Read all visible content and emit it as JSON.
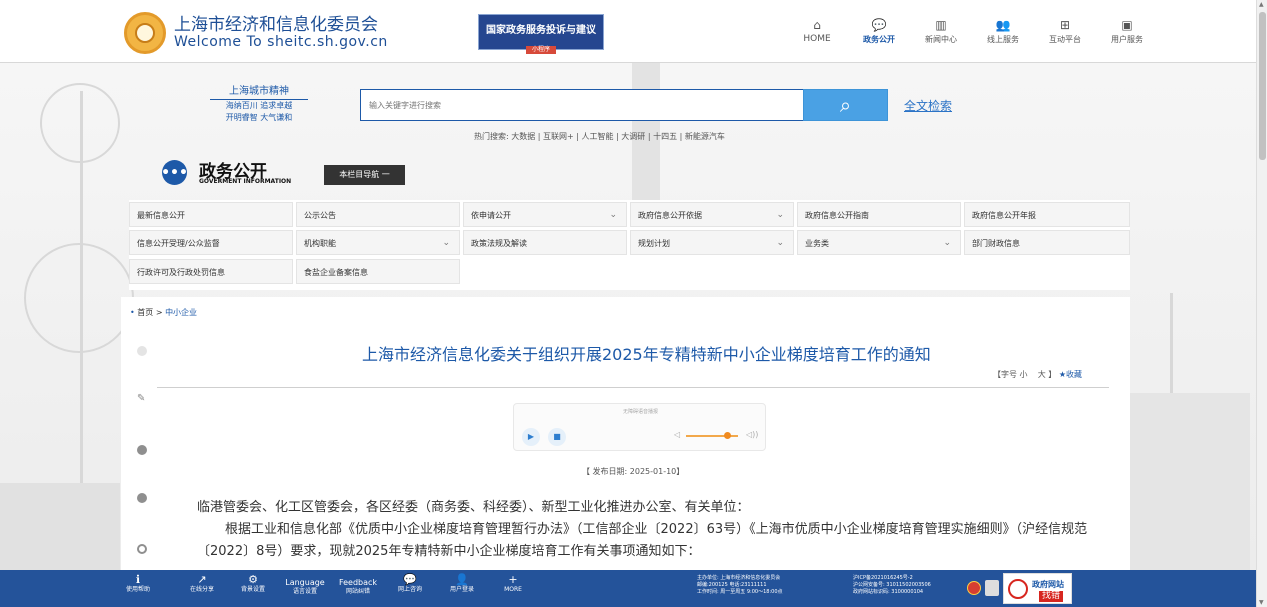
{
  "header": {
    "title": "上海市经济和信息化委员会",
    "subtitle": "Welcome To sheitc.sh.gov.cn",
    "banner": {
      "title": "国家政务服务投诉与建议",
      "sub": "小程序"
    },
    "nav": [
      {
        "label": "HOME",
        "icon": "home-icon",
        "glyph": "⌂"
      },
      {
        "label": "政务公开",
        "icon": "chat-icon",
        "glyph": "💬"
      },
      {
        "label": "新闻中心",
        "icon": "book-icon",
        "glyph": "▥"
      },
      {
        "label": "线上服务",
        "icon": "users-icon",
        "glyph": "👥"
      },
      {
        "label": "互动平台",
        "icon": "grid-icon",
        "glyph": "⊞"
      },
      {
        "label": "用户服务",
        "icon": "user-service-icon",
        "glyph": "▣"
      }
    ]
  },
  "hero": {
    "motto": {
      "title": "上海城市精神",
      "line1": "海纳百川 追求卓越",
      "line2": "开明睿智 大气谦和"
    },
    "search_placeholder": "输入关键字进行搜索",
    "search_icon": "search-icon",
    "full_search": "全文检索",
    "hot_search": "热门搜索: 大数据 | 互联网+ | 人工智能 | 大调研 | 十四五 | 新能源汽车"
  },
  "section": {
    "title": "政务公开",
    "subtitle": "GOVERMENT INFORMATION",
    "catalog_button": "本栏目导航 一"
  },
  "menu": [
    [
      "最新信息公开",
      "公示公告",
      "依申请公开",
      "政府信息公开依据",
      "政府信息公开指南",
      "政府信息公开年报"
    ],
    [
      "信息公开受理/公众监督",
      "机构职能",
      "政策法规及解读",
      "规划计划",
      "业务类",
      "部门财政信息"
    ],
    [
      "行政许可及行政处罚信息",
      "食盐企业备案信息"
    ]
  ],
  "breadcrumb": {
    "home": "首页",
    "separator": ">",
    "current": "中小企业"
  },
  "article": {
    "title": "上海市经济信息化委关于组织开展2025年专精特新中小企业梯度培育工作的通知",
    "font_label": "【字号",
    "font_small": "小",
    "font_large": "大",
    "font_end": "】",
    "favorite": "★收藏",
    "audio_status": "无障碍语音播报",
    "publish_date": "【 发布日期: 2025-01-10】",
    "paragraphs": [
      "临港管委会、化工区管委会，各区经委（商务委、科经委）、新型工业化推进办公室、有关单位：",
      "根据工业和信息化部《优质中小企业梯度培育管理暂行办法》（工信部企业〔2022〕63号）《上海市优质中小企业梯度培育管理实施细则》（沪经信规范〔2022〕8号）要求，现就2025年专精特新中小企业梯度培育工作有关事项通知如下："
    ]
  },
  "footer": {
    "items": [
      {
        "label": "使用帮助",
        "icon": "info-icon",
        "glyph": "ℹ"
      },
      {
        "label": "在线分享",
        "icon": "share-icon",
        "glyph": "↗"
      },
      {
        "label": "背景设置",
        "icon": "settings-icon",
        "glyph": "⚙"
      },
      {
        "label": "Language",
        "sub": "语言设置"
      },
      {
        "label": "Feedback",
        "sub": "网站纠错"
      },
      {
        "label": "网上咨询",
        "icon": "chat-bubble-icon",
        "glyph": "💬"
      },
      {
        "label": "用户登录",
        "icon": "user-login-icon",
        "glyph": "👤"
      },
      {
        "label": "MORE",
        "icon": "plus-icon",
        "glyph": "+"
      }
    ],
    "info_lines": [
      "主办单位: 上海市经济和信息化委员会",
      "邮编:200125 电话:23111111",
      "工作时间: 周一至周五 9:00～18:00点"
    ],
    "record_lines": [
      "沪ICP备2021016245号-2",
      "沪公网安备号: 31011502003506",
      "政府网站标识码: 3100000104"
    ],
    "error_badge": {
      "title": "政府网站",
      "sub": "找错"
    }
  }
}
